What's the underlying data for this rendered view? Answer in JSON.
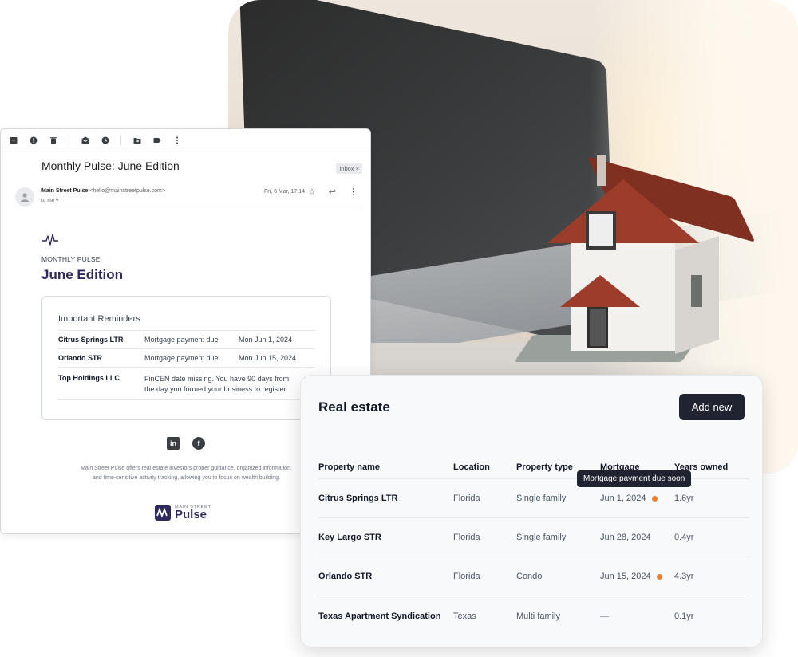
{
  "email": {
    "subject": "Monthly Pulse: June Edition",
    "inbox_chip": "Inbox ×",
    "sender_name": "Main Street Pulse",
    "sender_email": "<hello@mainstreetpulse.com>",
    "to": "to me ▾",
    "date": "Fri, 6 Mar, 17:14",
    "brand_label": "MONTHLY PULSE",
    "edition_title": "June Edition",
    "reminders": {
      "title": "Important Reminders",
      "rows": [
        {
          "entity": "Citrus Springs LTR",
          "note": "Mortgage payment due",
          "date": "Mon Jun 1, 2024"
        },
        {
          "entity": "Orlando STR",
          "note": "Mortgage payment due",
          "date": "Mon Jun 15, 2024"
        },
        {
          "entity": "Top Holdings LLC",
          "note_line1": "FinCEN date missing. You have 90 days from",
          "note_line2": "the day you formed your business to register"
        }
      ]
    },
    "social": {
      "linkedin": "in",
      "facebook": "f"
    },
    "footer_text": "Main Street Pulse offers real estate investors proper guidance, organized information, and time-sensitive activity tracking, allowing you to focus on wealth building.",
    "footer_logo_small": "MAIN STREET",
    "footer_logo_big": "Pulse"
  },
  "real_estate": {
    "title": "Real estate",
    "add_button": "Add new",
    "columns": [
      "Property name",
      "Location",
      "Property type",
      "Mortgage",
      "Years owned"
    ],
    "tooltip": "Mortgage payment due soon",
    "rows": [
      {
        "name": "Citrus Springs LTR",
        "location": "Florida",
        "type": "Single family",
        "mortgage": "Jun 1, 2024",
        "years": "1.6yr"
      },
      {
        "name": "Key Largo STR",
        "location": "Florida",
        "type": "Single family",
        "mortgage": "Jun 28, 2024",
        "years": "0.4yr"
      },
      {
        "name": "Orlando STR",
        "location": "Florida",
        "type": "Condo",
        "mortgage": "Jun 15, 2024",
        "years": "4.3yr"
      },
      {
        "name": "Texas Apartment Syndication",
        "location": "Texas",
        "type": "Multi family",
        "mortgage": "—",
        "years": "0.1yr"
      }
    ]
  },
  "colors": {
    "accent_dark": "#1f2430",
    "brand_purple": "#2e2a5e",
    "alert_orange": "#f07c2e"
  },
  "icons": [
    "archive-icon",
    "report-spam-icon",
    "delete-icon",
    "mark-unread-icon",
    "snooze-icon",
    "move-to-icon",
    "label-icon",
    "more-icon",
    "star-icon",
    "reply-icon"
  ]
}
